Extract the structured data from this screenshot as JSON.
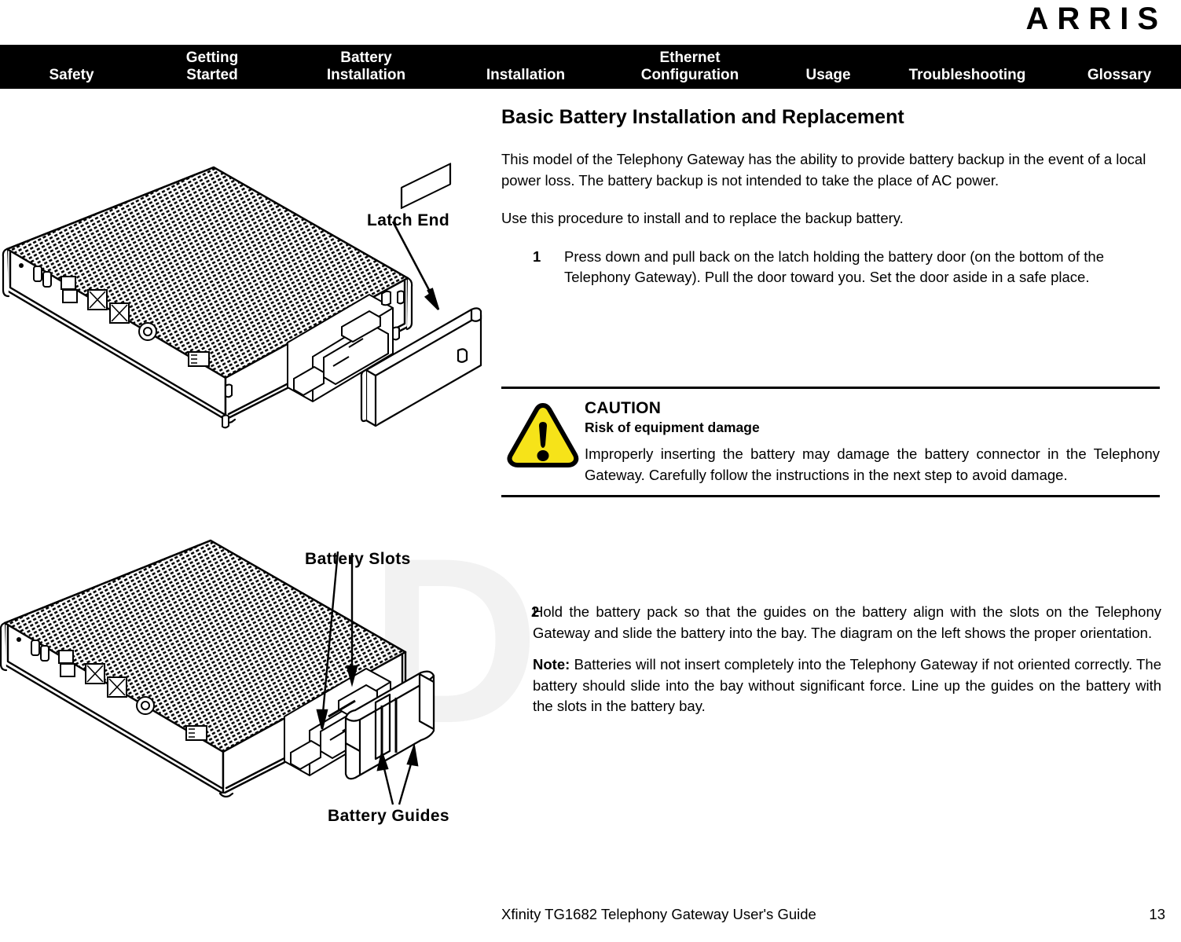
{
  "brand": {
    "logo_text": "ARRIS"
  },
  "nav": {
    "items": [
      {
        "label": "Safety"
      },
      {
        "label": "Getting\nStarted"
      },
      {
        "label": "Battery\nInstallation"
      },
      {
        "label": "Installation"
      },
      {
        "label": "Ethernet\nConfiguration"
      },
      {
        "label": "Usage"
      },
      {
        "label": "Troubleshooting"
      },
      {
        "label": "Glossary"
      }
    ]
  },
  "main": {
    "title": "Basic Battery Installation and Replacement",
    "intro_paragraph": "This model of the Telephony Gateway has the ability to provide battery backup in the event of a local power loss. The battery backup is not intended to take the place of AC power.",
    "procedure_lead": "Use this procedure to install and to replace the backup battery.",
    "step1": {
      "number": "1",
      "text": "Press down and pull back on the latch holding the battery door (on the bot-tom of the Telephony Gateway). Pull the door toward you. Set the door aside in a safe place."
    },
    "step2": {
      "number": "2",
      "text": "Hold the battery pack so that the guides on the battery align with the slots on the Telephony Gateway and slide the battery into the bay. The diagram on the left shows the proper orientation."
    },
    "note": {
      "label": "Note:",
      "text": "Batteries will not insert completely into the Telephony Gateway if not oriented correctly. The battery should slide into the bay without significant force. Line up the guides on the battery with the slots in the battery bay."
    }
  },
  "caution": {
    "icon": "warning-triangle-icon",
    "title": "CAUTION",
    "subtitle": "Risk of equipment damage",
    "body": "Improperly inserting the battery may damage the battery connector in the Telephony Gateway. Carefully follow the instructions in the next step to avoid damage.",
    "icon_fill": "#F6E319",
    "icon_stroke": "#000000"
  },
  "figures": {
    "figure1": {
      "name": "telephony-gateway-battery-door-removal-diagram",
      "callout": "Latch End"
    },
    "figure2": {
      "name": "telephony-gateway-battery-insertion-diagram",
      "callout_top": "Battery Slots",
      "callout_bottom": "Battery Guides"
    }
  },
  "watermark": {
    "text": "D"
  },
  "footer": {
    "document_title": "Xfinity TG1682 Telephony Gateway User's Guide",
    "page_number": "13"
  }
}
